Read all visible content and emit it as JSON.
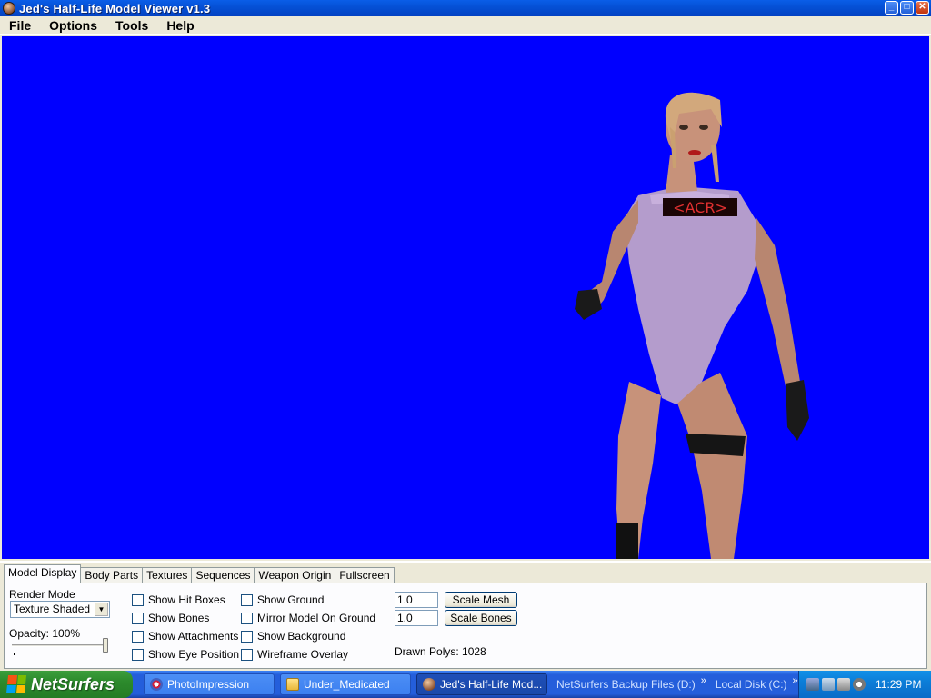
{
  "window": {
    "title": "Jed's Half-Life Model Viewer v1.3",
    "controls": {
      "minimize": "_",
      "maximize": "□",
      "close": "✕"
    }
  },
  "menu": [
    "File",
    "Options",
    "Tools",
    "Help"
  ],
  "viewport": {
    "background": "#0000ff",
    "model_label": "<ACR>"
  },
  "tabs": [
    "Model Display",
    "Body Parts",
    "Textures",
    "Sequences",
    "Weapon Origin",
    "Fullscreen"
  ],
  "active_tab": "Model Display",
  "model_display": {
    "render_mode_label": "Render Mode",
    "render_mode_value": "Texture Shaded",
    "opacity_label": "Opacity: 100%",
    "opacity_value": 1.0,
    "checkboxes_col1": [
      {
        "label": "Show Hit Boxes",
        "checked": false
      },
      {
        "label": "Show Bones",
        "checked": false
      },
      {
        "label": "Show Attachments",
        "checked": false
      },
      {
        "label": "Show Eye Position",
        "checked": false
      }
    ],
    "checkboxes_col2": [
      {
        "label": "Show Ground",
        "checked": false
      },
      {
        "label": "Mirror Model On Ground",
        "checked": false
      },
      {
        "label": "Show Background",
        "checked": false
      },
      {
        "label": "Wireframe Overlay",
        "checked": false
      }
    ],
    "scale_mesh_value": "1.0",
    "scale_mesh_button": "Scale Mesh",
    "scale_bones_value": "1.0",
    "scale_bones_button": "Scale Bones",
    "drawn_polys": "Drawn Polys: 1028"
  },
  "taskbar": {
    "start_label": "NetSurfers",
    "tasks": [
      {
        "label": "PhotoImpression",
        "icon": "photo-icon"
      },
      {
        "label": "Under_Medicated",
        "icon": "folder-icon"
      },
      {
        "label": "Jed's Half-Life Mod...",
        "icon": "halflife-icon",
        "active": true
      }
    ],
    "quick_items": [
      "NetSurfers Backup Files (D:)",
      "Local Disk (C:)"
    ],
    "chevron": "»",
    "clock": "11:29 PM"
  }
}
